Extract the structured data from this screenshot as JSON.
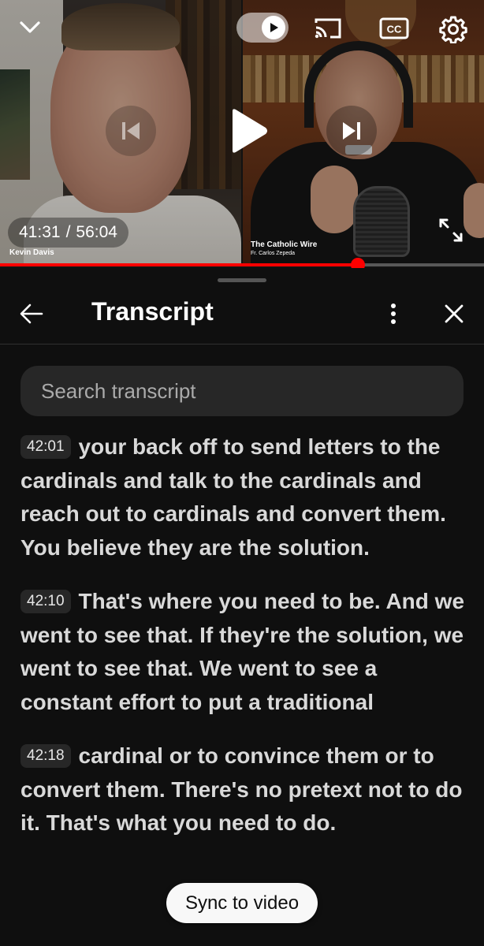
{
  "player": {
    "current_time": "41:31",
    "separator": "/",
    "duration": "56:04",
    "progress": 0.74,
    "left_speaker": "Kevin Davis",
    "right_channel": "The Catholic Wire",
    "right_speaker": "Fr. Carlos Zepeda",
    "accent_color": "#ff0000",
    "icons": {
      "collapse": "chevron-down-icon",
      "autoplay": "autoplay-toggle-icon",
      "cast": "cast-icon",
      "captions": "cc-icon",
      "settings": "gear-icon",
      "previous": "skip-previous-icon",
      "play": "play-icon",
      "next": "skip-next-icon",
      "fullscreen": "fullscreen-icon"
    },
    "cc_label": "CC"
  },
  "transcript": {
    "title": "Transcript",
    "search_placeholder": "Search transcript",
    "segments": [
      {
        "time": "42:01",
        "text": "your back off to send letters to the cardinals and talk to the cardinals and reach out to cardinals and convert them. You believe they are the solution."
      },
      {
        "time": "42:10",
        "text": "That's where you need to be. And we went to see that. If they're the solution, we went to see that. We went to see a constant effort to put a traditional"
      },
      {
        "time": "42:18",
        "text": "cardinal or to convince them or to convert them. There's no pretext not to do it. That's what you need to do."
      }
    ],
    "sync_label": "Sync to video",
    "icons": {
      "back": "arrow-back-icon",
      "more": "more-vertical-icon",
      "close": "close-icon"
    }
  }
}
